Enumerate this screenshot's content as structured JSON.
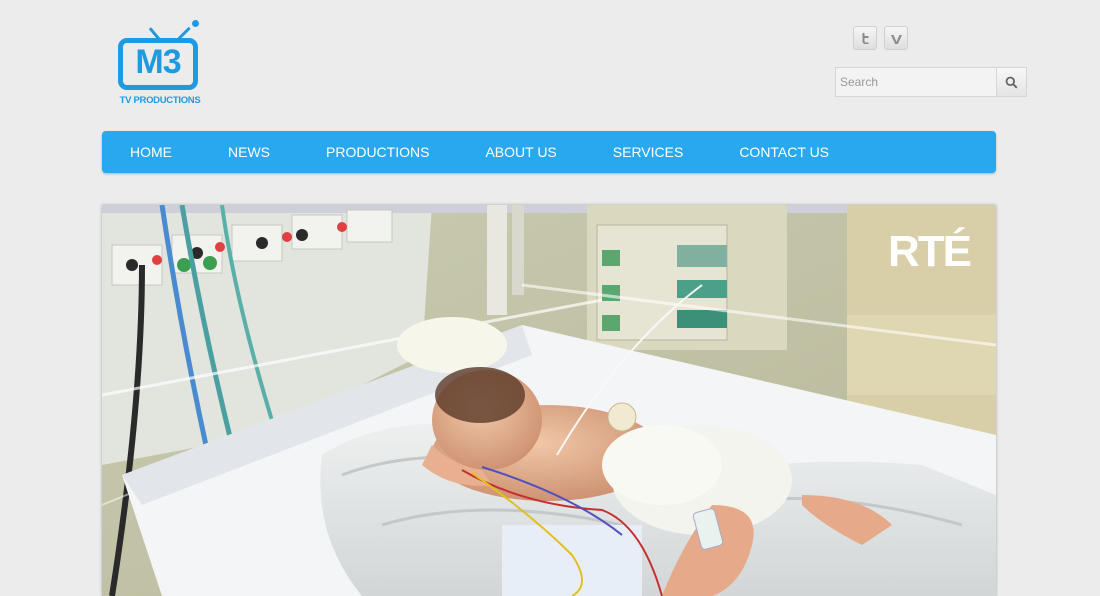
{
  "logo": {
    "main_text": "M3",
    "sub_text": "TV PRODUCTIONS",
    "brand_color": "#1e9be0"
  },
  "social": [
    {
      "name": "twitter",
      "glyph": "t"
    },
    {
      "name": "vimeo",
      "glyph": "v"
    }
  ],
  "search": {
    "placeholder": "Search",
    "value": ""
  },
  "nav": {
    "color": "#29a8ef",
    "items": [
      {
        "label": "HOME"
      },
      {
        "label": "NEWS"
      },
      {
        "label": "PRODUCTIONS"
      },
      {
        "label": "ABOUT US"
      },
      {
        "label": "SERVICES"
      },
      {
        "label": "CONTACT US"
      }
    ]
  },
  "hero": {
    "watermark": "RTÉ"
  }
}
